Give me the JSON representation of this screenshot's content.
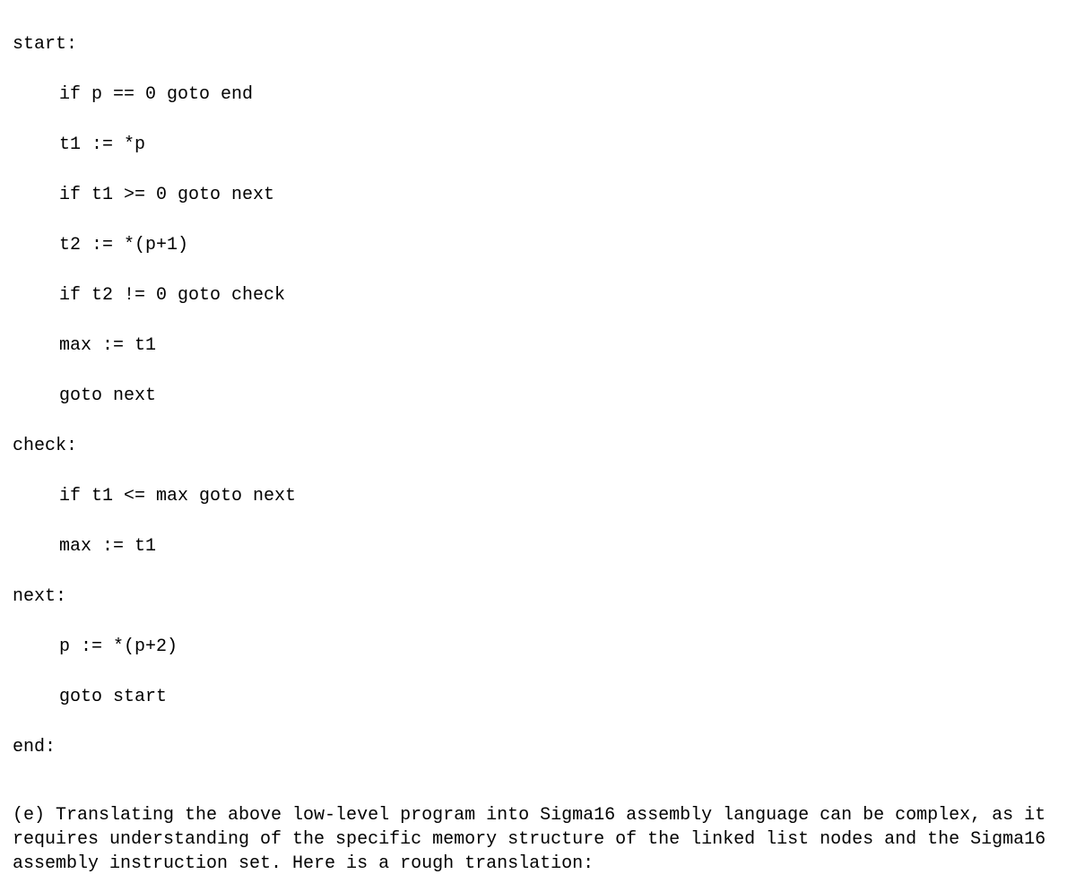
{
  "code": {
    "l1": "start:",
    "l2": "if p == 0 goto end",
    "l3": "t1 := *p",
    "l4": "if t1 >= 0 goto next",
    "l5": "t2 := *(p+1)",
    "l6": "if t2 != 0 goto check",
    "l7": "max := t1",
    "l8": "goto next",
    "l9": "check:",
    "l10": "if t1 <= max goto next",
    "l11": "max := t1",
    "l12": "next:",
    "l13": "p := *(p+2)",
    "l14": "goto start",
    "l15": "end:"
  },
  "paragraph": "(e) Translating the above low-level program into Sigma16 assembly language can be complex, as it requires understanding of the specific memory structure of the linked list nodes and the Sigma16 assembly instruction set. Here is a rough translation:"
}
